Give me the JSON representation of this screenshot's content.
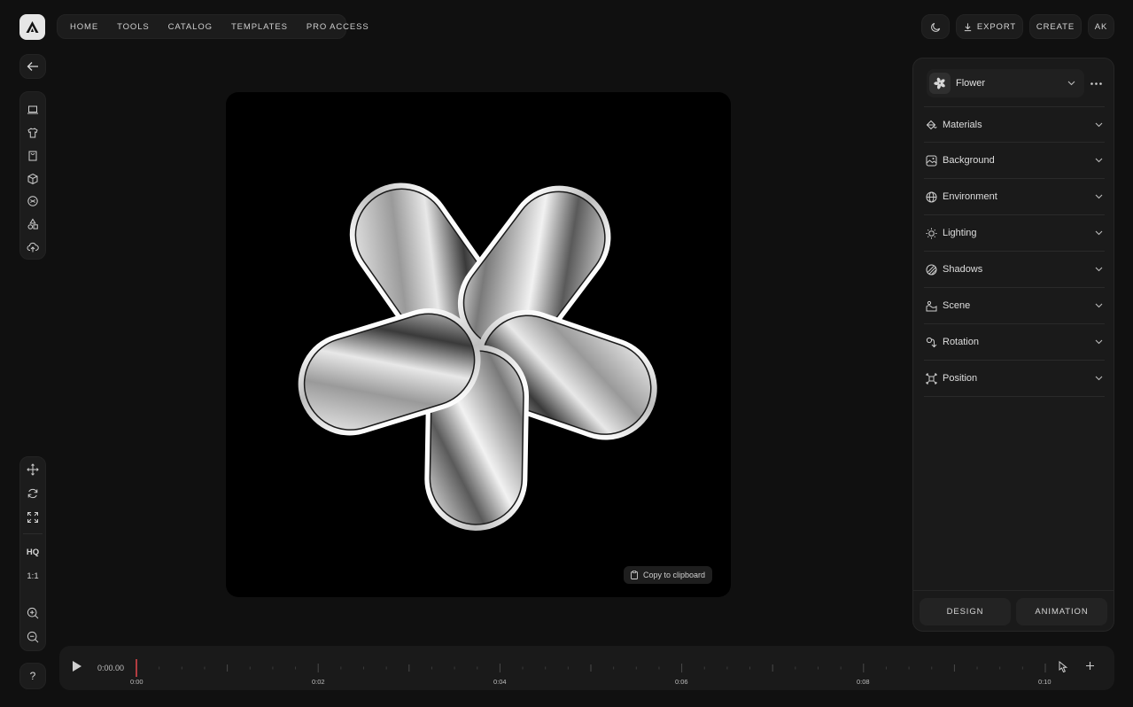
{
  "topnav": {
    "items": [
      "HOME",
      "TOOLS",
      "CATALOG",
      "TEMPLATES",
      "PRO ACCESS"
    ]
  },
  "topright": {
    "export_label": "EXPORT",
    "create_label": "CREATE",
    "avatar_label": "AK"
  },
  "left_tools": [
    "laptop-icon",
    "tshirt-icon",
    "bag-icon",
    "cube-icon",
    "sticker-icon",
    "shapes-icon",
    "upload-icon"
  ],
  "view_tools": {
    "hq_label": "HQ",
    "ratio_label": "1:1",
    "help_label": "?"
  },
  "canvas": {
    "copy_label": "Copy to clipboard"
  },
  "panel": {
    "model_name": "Flower",
    "sections": [
      {
        "label": "Materials",
        "icon": "materials-icon"
      },
      {
        "label": "Background",
        "icon": "background-icon"
      },
      {
        "label": "Environment",
        "icon": "globe-icon"
      },
      {
        "label": "Lighting",
        "icon": "sun-icon"
      },
      {
        "label": "Shadows",
        "icon": "shadows-icon"
      },
      {
        "label": "Scene",
        "icon": "scene-icon"
      },
      {
        "label": "Rotation",
        "icon": "rotation-icon"
      },
      {
        "label": "Position",
        "icon": "position-icon"
      }
    ],
    "tab_design": "DESIGN",
    "tab_animation": "ANIMATION"
  },
  "timeline": {
    "current_time": "0:00.00",
    "labels": [
      "0:00",
      "0:02",
      "0:04",
      "0:06",
      "0:08",
      "0:10"
    ]
  },
  "colors": {
    "background": "#101010",
    "panel": "#1a1a1a",
    "playhead": "#e5484d"
  }
}
